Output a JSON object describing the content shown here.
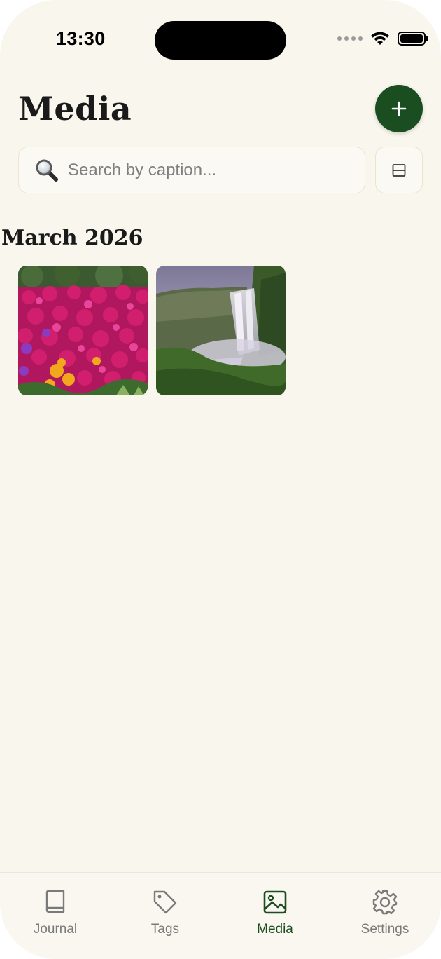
{
  "status_bar": {
    "time": "13:30"
  },
  "header": {
    "title": "Media",
    "add_icon": "plus-icon"
  },
  "search": {
    "placeholder": "Search by caption...",
    "value": "",
    "icon": "magnifying-glass-icon",
    "layout_toggle_icon": "split-view-icon"
  },
  "sections": [
    {
      "heading": "March 2026",
      "items": [
        {
          "subject": "pink-flowers"
        },
        {
          "subject": "waterfall"
        }
      ]
    }
  ],
  "tab_bar": {
    "items": [
      {
        "label": "Journal",
        "icon": "book-icon",
        "active": false
      },
      {
        "label": "Tags",
        "icon": "tag-icon",
        "active": false
      },
      {
        "label": "Media",
        "icon": "image-icon",
        "active": true
      },
      {
        "label": "Settings",
        "icon": "gear-icon",
        "active": false
      }
    ]
  },
  "colors": {
    "background": "#f9f6ee",
    "accent": "#1a4d1f",
    "inactive": "#7a7a7a",
    "field_border": "#ece4cc"
  }
}
